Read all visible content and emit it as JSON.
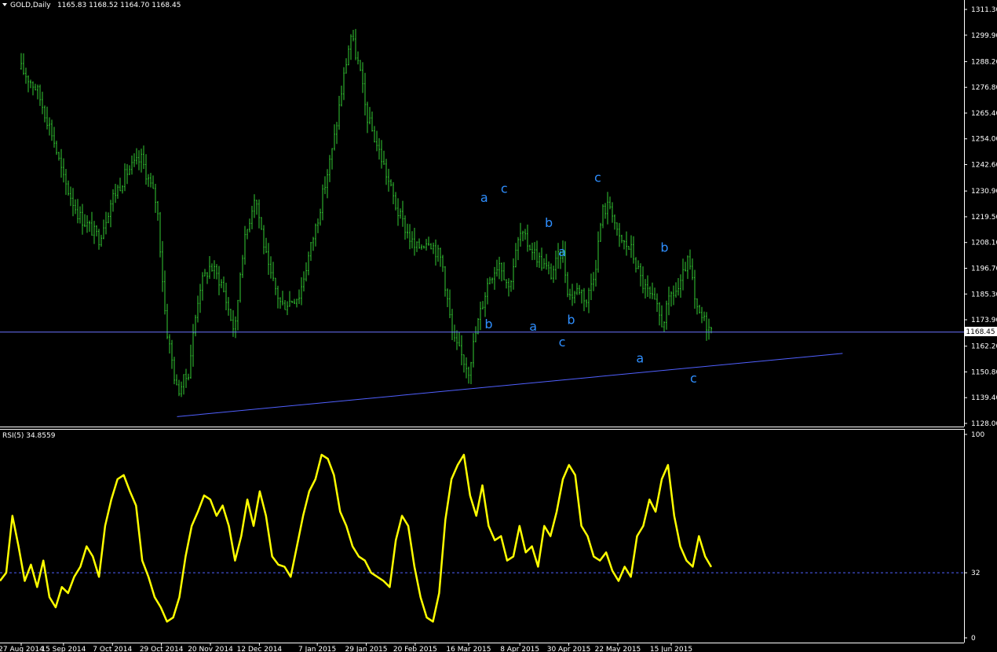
{
  "main_header": {
    "symbol": "GOLD,Daily",
    "ohlc": "1165.83 1168.52 1164.70 1168.45"
  },
  "rsi_header": {
    "label": "RSI(5) 34.8559"
  },
  "current_price_tag": "1168.45",
  "colors": {
    "background": "#000000",
    "candle": "#33cc33",
    "rsi_line": "#ffff00",
    "trendline": "#5060ff",
    "price_line": "#6a73ff",
    "wave_label": "#2f8fff",
    "grid": "#ffffff"
  },
  "chart_data": [
    {
      "type": "candlestick",
      "title": "GOLD,Daily",
      "ylim": [
        1128.0,
        1311.3
      ],
      "y_ticks": [
        "1311.30",
        "1299.90",
        "1288.20",
        "1276.80",
        "1265.40",
        "1254.00",
        "1242.60",
        "1230.90",
        "1219.50",
        "1208.10",
        "1196.70",
        "1185.30",
        "1173.90",
        "1162.20",
        "1150.80",
        "1139.40",
        "1128.00"
      ],
      "x_ticks": [
        "27 Aug 2014",
        "15 Sep 2014",
        "7 Oct 2014",
        "29 Oct 2014",
        "20 Nov 2014",
        "12 Dec 2014",
        "7 Jan 2015",
        "29 Jan 2015",
        "20 Feb 2015",
        "16 Mar 2015",
        "8 Apr 2015",
        "30 Apr 2015",
        "22 May 2015",
        "15 Jun 2015"
      ],
      "close_path": [
        {
          "date": "2014-08-27",
          "close": 1285
        },
        {
          "date": "2014-09-03",
          "close": 1276
        },
        {
          "date": "2014-09-10",
          "close": 1256
        },
        {
          "date": "2014-09-15",
          "close": 1236
        },
        {
          "date": "2014-09-22",
          "close": 1220
        },
        {
          "date": "2014-10-01",
          "close": 1210
        },
        {
          "date": "2014-10-07",
          "close": 1228
        },
        {
          "date": "2014-10-14",
          "close": 1240
        },
        {
          "date": "2014-10-20",
          "close": 1245
        },
        {
          "date": "2014-10-27",
          "close": 1225
        },
        {
          "date": "2014-10-31",
          "close": 1172
        },
        {
          "date": "2014-11-05",
          "close": 1142
        },
        {
          "date": "2014-11-10",
          "close": 1150
        },
        {
          "date": "2014-11-15",
          "close": 1188
        },
        {
          "date": "2014-11-20",
          "close": 1198
        },
        {
          "date": "2014-11-25",
          "close": 1190
        },
        {
          "date": "2014-12-01",
          "close": 1168
        },
        {
          "date": "2014-12-04",
          "close": 1202
        },
        {
          "date": "2014-12-10",
          "close": 1230
        },
        {
          "date": "2014-12-16",
          "close": 1196
        },
        {
          "date": "2014-12-22",
          "close": 1180
        },
        {
          "date": "2014-12-30",
          "close": 1185
        },
        {
          "date": "2015-01-07",
          "close": 1218
        },
        {
          "date": "2015-01-14",
          "close": 1250
        },
        {
          "date": "2015-01-19",
          "close": 1282
        },
        {
          "date": "2015-01-22",
          "close": 1300
        },
        {
          "date": "2015-01-26",
          "close": 1285
        },
        {
          "date": "2015-01-29",
          "close": 1265
        },
        {
          "date": "2015-02-05",
          "close": 1245
        },
        {
          "date": "2015-02-12",
          "close": 1222
        },
        {
          "date": "2015-02-20",
          "close": 1205
        },
        {
          "date": "2015-02-26",
          "close": 1210
        },
        {
          "date": "2015-03-04",
          "close": 1200
        },
        {
          "date": "2015-03-09",
          "close": 1165
        },
        {
          "date": "2015-03-16",
          "close": 1152
        },
        {
          "date": "2015-03-20",
          "close": 1172
        },
        {
          "date": "2015-03-25",
          "close": 1192
        },
        {
          "date": "2015-03-30",
          "close": 1200
        },
        {
          "date": "2015-04-03",
          "close": 1188
        },
        {
          "date": "2015-04-08",
          "close": 1212
        },
        {
          "date": "2015-04-13",
          "close": 1206
        },
        {
          "date": "2015-04-17",
          "close": 1200
        },
        {
          "date": "2015-04-22",
          "close": 1194
        },
        {
          "date": "2015-04-27",
          "close": 1205
        },
        {
          "date": "2015-04-30",
          "close": 1184
        },
        {
          "date": "2015-05-05",
          "close": 1188
        },
        {
          "date": "2015-05-08",
          "close": 1182
        },
        {
          "date": "2015-05-12",
          "close": 1198
        },
        {
          "date": "2015-05-15",
          "close": 1222
        },
        {
          "date": "2015-05-19",
          "close": 1225
        },
        {
          "date": "2015-05-22",
          "close": 1210
        },
        {
          "date": "2015-05-28",
          "close": 1205
        },
        {
          "date": "2015-06-02",
          "close": 1190
        },
        {
          "date": "2015-06-08",
          "close": 1180
        },
        {
          "date": "2015-06-11",
          "close": 1172
        },
        {
          "date": "2015-06-15",
          "close": 1185
        },
        {
          "date": "2015-06-19",
          "close": 1188
        },
        {
          "date": "2015-06-22",
          "close": 1200
        },
        {
          "date": "2015-06-24",
          "close": 1195
        },
        {
          "date": "2015-06-26",
          "close": 1178
        },
        {
          "date": "2015-07-01",
          "close": 1172
        },
        {
          "date": "2015-07-03",
          "close": 1168.45
        }
      ],
      "horizontal_line": 1168.45,
      "trendline": {
        "from": {
          "date": "2014-11-05",
          "price": 1131
        },
        "to": {
          "date": "2015-08-31",
          "price": 1159
        }
      },
      "wave_annotations": [
        {
          "text": "a",
          "date": "2015-03-23",
          "price": 1226
        },
        {
          "text": "c",
          "date": "2015-04-01",
          "price": 1230
        },
        {
          "text": "b",
          "date": "2015-03-25",
          "price": 1170
        },
        {
          "text": "a",
          "date": "2015-04-14",
          "price": 1169
        },
        {
          "text": "b",
          "date": "2015-04-21",
          "price": 1215
        },
        {
          "text": "a",
          "date": "2015-04-27",
          "price": 1202
        },
        {
          "text": "c",
          "date": "2015-04-27",
          "price": 1162
        },
        {
          "text": "b",
          "date": "2015-05-01",
          "price": 1172
        },
        {
          "text": "c",
          "date": "2015-05-13",
          "price": 1235
        },
        {
          "text": "b",
          "date": "2015-06-12",
          "price": 1204
        },
        {
          "text": "a",
          "date": "2015-06-01",
          "price": 1155
        },
        {
          "text": "c",
          "date": "2015-06-25",
          "price": 1146
        }
      ]
    },
    {
      "type": "line",
      "title": "RSI(5) 34.8559",
      "ylim": [
        0,
        100
      ],
      "y_ticks": [
        "100",
        "32",
        "0"
      ],
      "level_line": 32,
      "series": [
        {
          "values": [
            28,
            32,
            60,
            45,
            28,
            36,
            25,
            38,
            20,
            15,
            25,
            22,
            30,
            35,
            45,
            40,
            30,
            55,
            68,
            78,
            80,
            72,
            65,
            38,
            30,
            20,
            15,
            8,
            10,
            20,
            40,
            55,
            62,
            70,
            68,
            60,
            65,
            55,
            38,
            50,
            68,
            55,
            72,
            60,
            40,
            36,
            35,
            30,
            45,
            60,
            72,
            78,
            90,
            88,
            80,
            62,
            55,
            45,
            40,
            38,
            32,
            30,
            28,
            25,
            48,
            60,
            55,
            35,
            20,
            10,
            8,
            22,
            58,
            78,
            85,
            90,
            70,
            60,
            75,
            55,
            48,
            50,
            38,
            40,
            55,
            42,
            45,
            35,
            55,
            50,
            62,
            78,
            85,
            80,
            55,
            50,
            40,
            38,
            42,
            33,
            28,
            35,
            30,
            50,
            55,
            68,
            62,
            78,
            85,
            60,
            45,
            38,
            35,
            50,
            40,
            34.86
          ]
        }
      ]
    }
  ]
}
